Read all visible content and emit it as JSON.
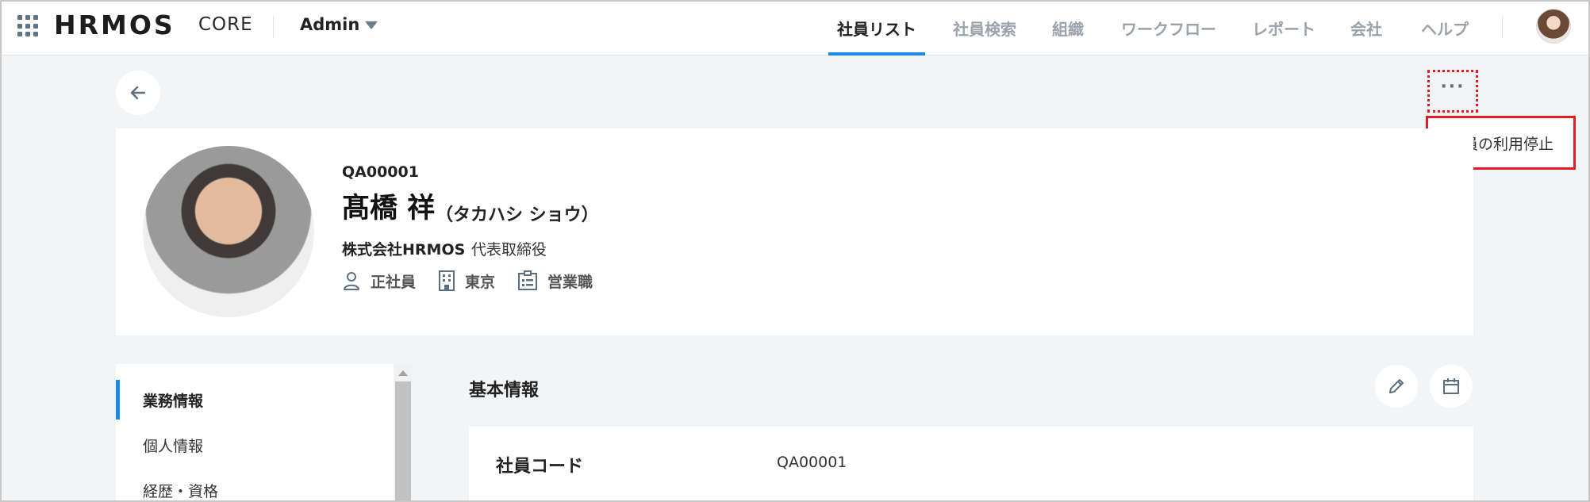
{
  "header": {
    "logo": "HRMOS",
    "product": "CORE",
    "role_selector": "Admin",
    "nav": [
      {
        "label": "社員リスト",
        "active": true
      },
      {
        "label": "社員検索",
        "active": false
      },
      {
        "label": "組織",
        "active": false
      },
      {
        "label": "ワークフロー",
        "active": false
      },
      {
        "label": "レポート",
        "active": false
      },
      {
        "label": "会社",
        "active": false
      },
      {
        "label": "ヘルプ",
        "active": false
      }
    ],
    "icons": {
      "apps": "apps-grid-icon",
      "caret": "chevron-down-icon",
      "user": "user-avatar"
    }
  },
  "toolbar": {
    "back_icon": "arrow-left-icon",
    "more_icon": "more-horizontal-icon",
    "more_label": "···",
    "menu_items": [
      "社員の利用停止"
    ]
  },
  "profile": {
    "code": "QA00001",
    "name": "髙橋 祥",
    "kana": "（タカハシ ショウ）",
    "company": "株式会社HRMOS",
    "position": "代表取締役",
    "attributes": [
      {
        "icon": "person-icon",
        "label": "正社員"
      },
      {
        "icon": "building-icon",
        "label": "東京"
      },
      {
        "icon": "job-badge-icon",
        "label": "営業職"
      }
    ]
  },
  "side_tabs": [
    {
      "label": "業務情報",
      "active": true
    },
    {
      "label": "個人情報",
      "active": false
    },
    {
      "label": "経歴・資格",
      "active": false
    }
  ],
  "main": {
    "section_title": "基本情報",
    "actions": [
      "edit-pencil-icon",
      "calendar-icon"
    ],
    "fields": [
      {
        "label": "社員コード",
        "value": "QA00001"
      }
    ]
  },
  "colors": {
    "accent": "#1a8ae6",
    "highlight": "#e41b23",
    "background": "#f3f4f5"
  }
}
